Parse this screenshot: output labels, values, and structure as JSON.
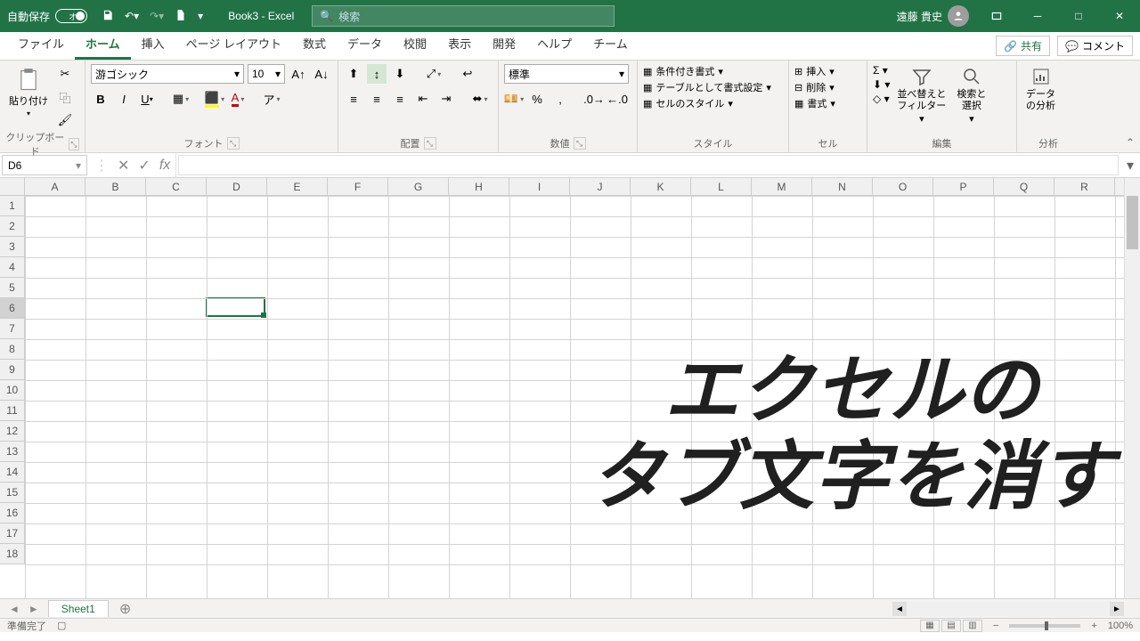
{
  "titlebar": {
    "autosave_label": "自動保存",
    "autosave_state": "オフ",
    "doc_title": "Book3 - Excel",
    "search_placeholder": "検索",
    "user_name": "遠藤 貴史"
  },
  "tabs": {
    "items": [
      "ファイル",
      "ホーム",
      "挿入",
      "ページ レイアウト",
      "数式",
      "データ",
      "校閲",
      "表示",
      "開発",
      "ヘルプ",
      "チーム"
    ],
    "active_index": 1,
    "share": "共有",
    "comments": "コメント"
  },
  "ribbon": {
    "clipboard": {
      "paste": "貼り付け",
      "label": "クリップボード"
    },
    "font": {
      "name": "游ゴシック",
      "size": "10",
      "label": "フォント"
    },
    "align": {
      "label": "配置"
    },
    "number": {
      "format": "標準",
      "label": "数値"
    },
    "styles": {
      "cond": "条件付き書式",
      "table": "テーブルとして書式設定",
      "cell": "セルのスタイル",
      "label": "スタイル"
    },
    "cells": {
      "insert": "挿入",
      "delete": "削除",
      "format": "書式",
      "label": "セル"
    },
    "editing": {
      "sort": "並べ替えと\nフィルター",
      "find": "検索と\n選択",
      "label": "編集"
    },
    "analysis": {
      "data": "データ\nの分析",
      "label": "分析"
    }
  },
  "formula": {
    "namebox": "D6",
    "value": ""
  },
  "grid": {
    "cols": [
      "A",
      "B",
      "C",
      "D",
      "E",
      "F",
      "G",
      "H",
      "I",
      "J",
      "K",
      "L",
      "M",
      "N",
      "O",
      "P",
      "Q",
      "R"
    ],
    "rows": [
      1,
      2,
      3,
      4,
      5,
      6,
      7,
      8,
      9,
      10,
      11,
      12,
      13,
      14,
      15,
      16,
      17,
      18
    ],
    "active": {
      "col": 3,
      "row": 5
    }
  },
  "sheets": {
    "active": "Sheet1"
  },
  "status": {
    "ready": "準備完了",
    "zoom": "100%"
  },
  "overlay": {
    "line1": "エクセルの",
    "line2": "タブ文字を消す"
  }
}
